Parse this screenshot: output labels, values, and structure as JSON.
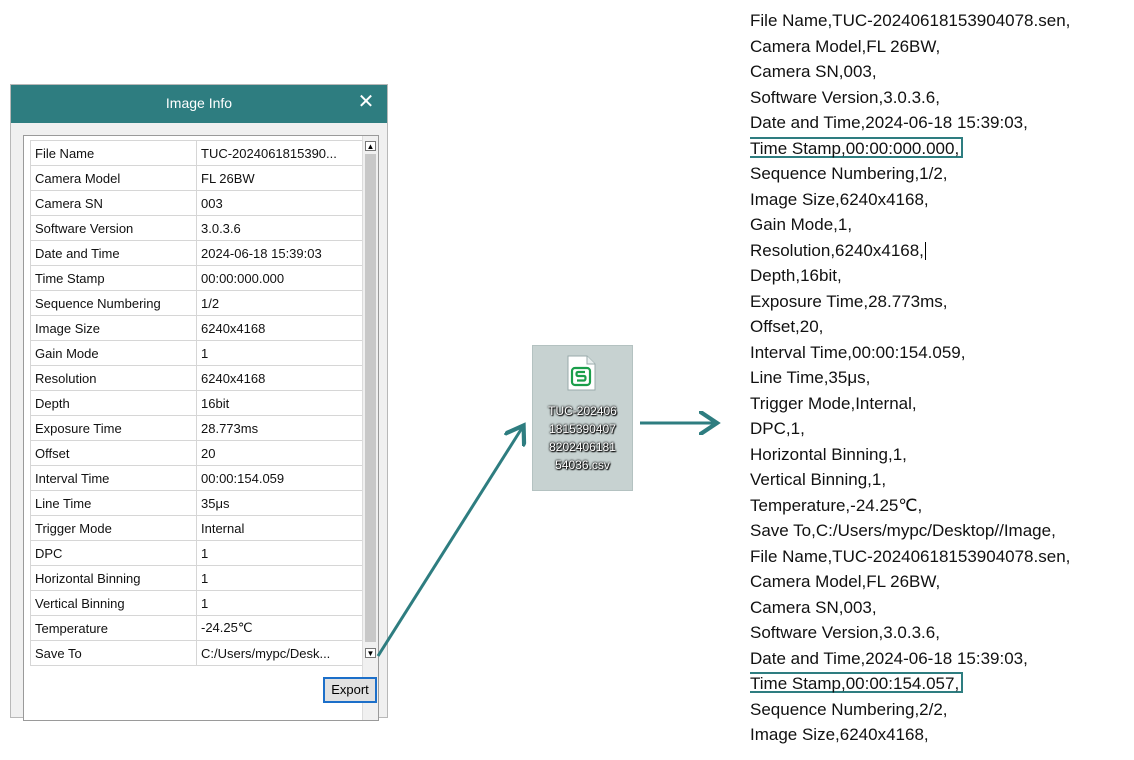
{
  "dialog": {
    "title": "Image Info",
    "close_glyph": "✕",
    "rows": [
      {
        "key": "File Name",
        "value": "TUC-2024061815390..."
      },
      {
        "key": "Camera Model",
        "value": "FL 26BW"
      },
      {
        "key": "Camera SN",
        "value": "003"
      },
      {
        "key": "Software Version",
        "value": "3.0.3.6"
      },
      {
        "key": "Date and Time",
        "value": "2024-06-18 15:39:03"
      },
      {
        "key": "Time Stamp",
        "value": "00:00:000.000"
      },
      {
        "key": "Sequence Numbering",
        "value": "1/2"
      },
      {
        "key": "Image Size",
        "value": "6240x4168"
      },
      {
        "key": "Gain Mode",
        "value": "1"
      },
      {
        "key": "Resolution",
        "value": "6240x4168"
      },
      {
        "key": "Depth",
        "value": "16bit"
      },
      {
        "key": "Exposure Time",
        "value": "28.773ms"
      },
      {
        "key": "Offset",
        "value": "20"
      },
      {
        "key": "Interval Time",
        "value": "00:00:154.059"
      },
      {
        "key": "Line Time",
        "value": "35μs"
      },
      {
        "key": "Trigger Mode",
        "value": "Internal"
      },
      {
        "key": "DPC",
        "value": "1"
      },
      {
        "key": "Horizontal Binning",
        "value": "1"
      },
      {
        "key": "Vertical Binning",
        "value": "1"
      },
      {
        "key": "Temperature",
        "value": "-24.25℃"
      },
      {
        "key": "Save To",
        "value": "C:/Users/mypc/Desk..."
      }
    ],
    "scroll_up_glyph": "▲",
    "scroll_down_glyph": "▼",
    "export_label": "Export"
  },
  "file": {
    "icon": "spreadsheet-s-icon",
    "name_lines": [
      "TUC-202406",
      "1815390407",
      "8202406181",
      "54036.csv"
    ]
  },
  "csv": {
    "lines": [
      "File Name,TUC-20240618153904078.sen,",
      "Camera Model,FL 26BW,",
      "Camera SN,003,",
      "Software Version,3.0.3.6,",
      "Date and Time,2024-06-18 15:39:03,",
      "Time Stamp,00:00:000.000,",
      "Sequence Numbering,1/2,",
      "Image Size,6240x4168,",
      "Gain Mode,1,",
      "Resolution,6240x4168,",
      "Depth,16bit,",
      "Exposure Time,28.773ms,",
      "Offset,20,",
      "Interval Time,00:00:154.059,",
      "Line Time,35μs,",
      "Trigger Mode,Internal,",
      "DPC,1,",
      "Horizontal Binning,1,",
      "Vertical Binning,1,",
      "Temperature,-24.25℃,",
      "Save To,C:/Users/mypc/Desktop//Image,",
      "File Name,TUC-20240618153904078.sen,",
      "Camera Model,FL 26BW,",
      "Camera SN,003,",
      "Software Version,3.0.3.6,",
      "Date and Time,2024-06-18 15:39:03,",
      "Time Stamp,00:00:154.057,",
      "Sequence Numbering,2/2,",
      "Image Size,6240x4168,"
    ],
    "highlighted_lines": [
      5,
      26
    ],
    "caret_line": 9
  },
  "colors": {
    "accent": "#2e7d80",
    "titlebar": "#2e7d80",
    "export_border": "#1c6fc9",
    "file_tile": "#c7d2d1",
    "file_icon_green": "#1a9e4a"
  }
}
